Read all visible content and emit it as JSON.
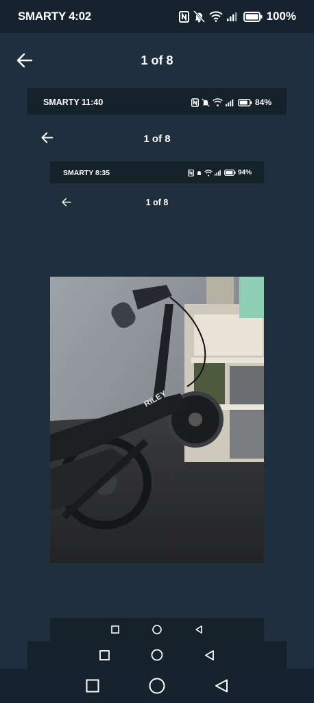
{
  "status_outer": {
    "carrier_time": "SMARTY 4:02",
    "battery": "100%"
  },
  "header1": {
    "title": "1 of 8"
  },
  "status2": {
    "carrier_time": "SMARTY 11:40",
    "battery": "84%"
  },
  "header2": {
    "title": "1 of 8"
  },
  "status3": {
    "carrier_time": "SMARTY 8:35",
    "battery": "94%"
  },
  "header3": {
    "title": "1 of 8"
  },
  "photo": {
    "brand_text": "RILEY"
  },
  "icons": {
    "back": "arrow-left-icon",
    "nfc": "nfc-icon",
    "mute": "bell-off-icon",
    "wifi": "wifi-icon",
    "signal": "signal-icon",
    "battery": "battery-icon",
    "recents": "square-icon",
    "home": "circle-icon",
    "back_nav": "triangle-back-icon"
  },
  "colors": {
    "background": "#1f2f3e",
    "bar": "#15212b",
    "text": "#ffffff"
  }
}
